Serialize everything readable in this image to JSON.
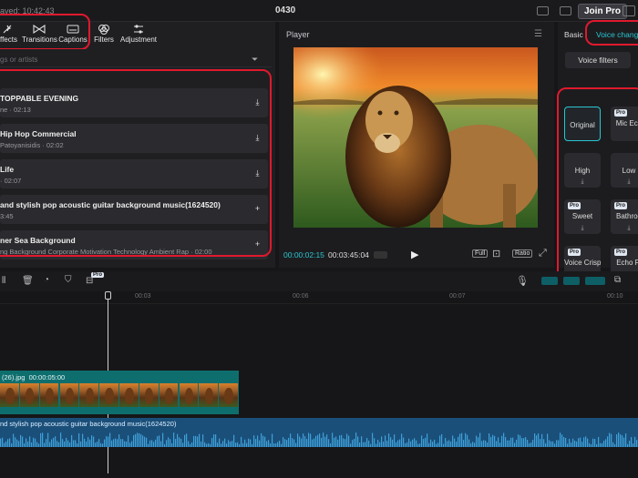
{
  "topbar": {
    "saved": "aved: 10:42:43",
    "title": "0430",
    "join_pro": "Join Pro"
  },
  "tools": {
    "effects": "ffects",
    "transitions": "Transitions",
    "captions": "Captions",
    "filters": "Filters",
    "adjustment": "Adjustment"
  },
  "search": {
    "placeholder": "gs or artists"
  },
  "tracks": [
    {
      "title": "TOPPABLE EVENING",
      "sub": "ne · 02:13",
      "action": "download"
    },
    {
      "title": "Hip Hop Commercial",
      "sub": "Patoyanisidis · 02:02",
      "action": "download"
    },
    {
      "title": "Life",
      "sub": "· 02:07",
      "action": "download"
    },
    {
      "title": "and stylish pop acoustic guitar background music(1624520)",
      "sub": "3:45",
      "action": "add"
    },
    {
      "title": "ner Sea Background",
      "sub": "ng Background Corporate Motivation Technology Ambient Rap · 02:00",
      "action": "add"
    }
  ],
  "player": {
    "label": "Player",
    "current_time": "00:00:02:15",
    "total_time": "00:03:45:04",
    "full": "Full",
    "ratio": "Ratio"
  },
  "right": {
    "tab_basic": "Basic",
    "tab_voice": "Voice chang",
    "voice_filters": "Voice filters",
    "tiles": [
      {
        "label": "Original",
        "pro": false,
        "selected": true
      },
      {
        "label": "Mic Ech",
        "pro": true,
        "selected": false
      },
      {
        "label": "High",
        "pro": false,
        "selected": false
      },
      {
        "label": "Low",
        "pro": false,
        "selected": false
      },
      {
        "label": "Sweet",
        "pro": true,
        "selected": false
      },
      {
        "label": "Bathroo",
        "pro": true,
        "selected": false
      },
      {
        "label": "Voice Crisper",
        "pro": true,
        "selected": false
      },
      {
        "label": "Echo Pl",
        "pro": true,
        "selected": false
      }
    ],
    "pro_badge": "Pro"
  },
  "timeline": {
    "pro_badge": "Pro",
    "ticks": [
      "00:03",
      "00:06",
      "00:07",
      "00:10"
    ],
    "video_clip_label": "(26).jpg  00:00:05:00",
    "audio_clip_label": "nd stylish pop acoustic guitar background music(1624520)"
  },
  "colors": {
    "accent": "#29c7d1",
    "highlight": "#e0192d",
    "audio": "#1a4f7a",
    "video": "#0e6e6e"
  }
}
